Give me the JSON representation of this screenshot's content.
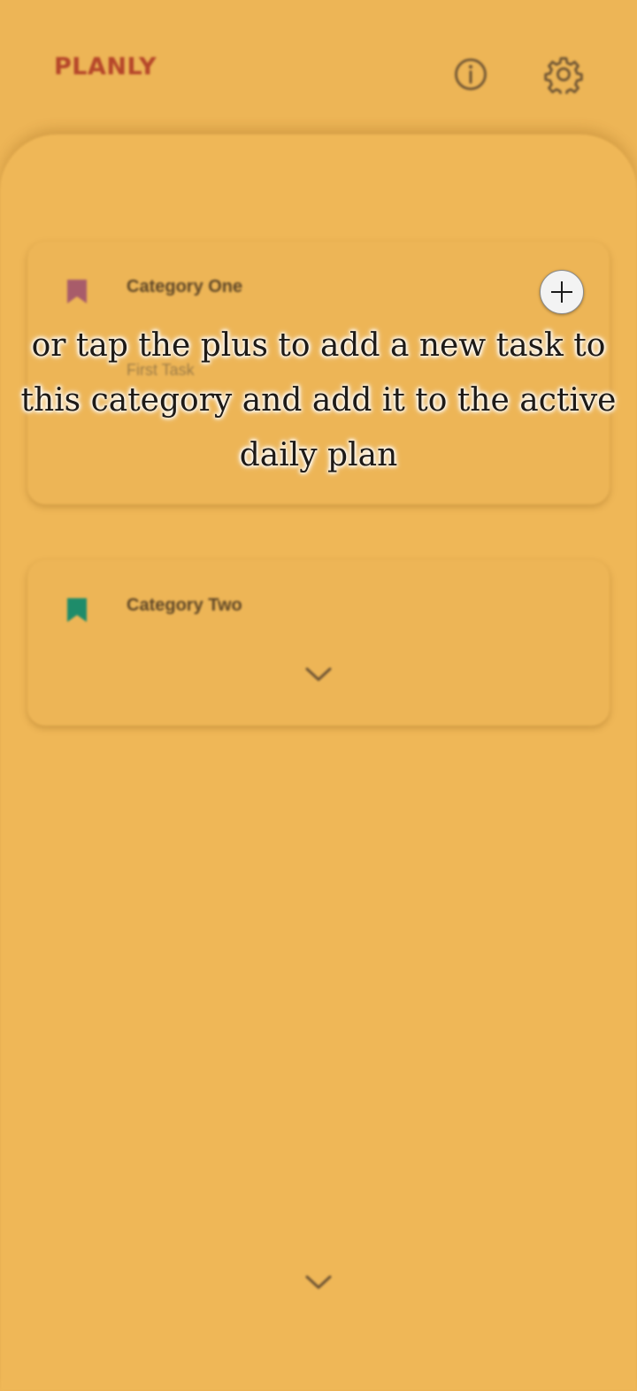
{
  "header": {
    "app_title": "PLANLY",
    "info_icon": "info-circle-icon",
    "settings_icon": "gear-icon"
  },
  "categories": [
    {
      "title": "Category One",
      "color": "#A85C6A",
      "tasks": [
        "First Task"
      ]
    },
    {
      "title": "Category Two",
      "color": "#1E8C6A",
      "tasks": []
    }
  ],
  "tutorial": {
    "hint_text": "or tap the plus to add a new task to this category and add it to the active daily plan",
    "plus_icon": "plus-icon"
  },
  "colors": {
    "background": "#EDB556",
    "title": "#B5462A",
    "icon": "#6B5233"
  }
}
